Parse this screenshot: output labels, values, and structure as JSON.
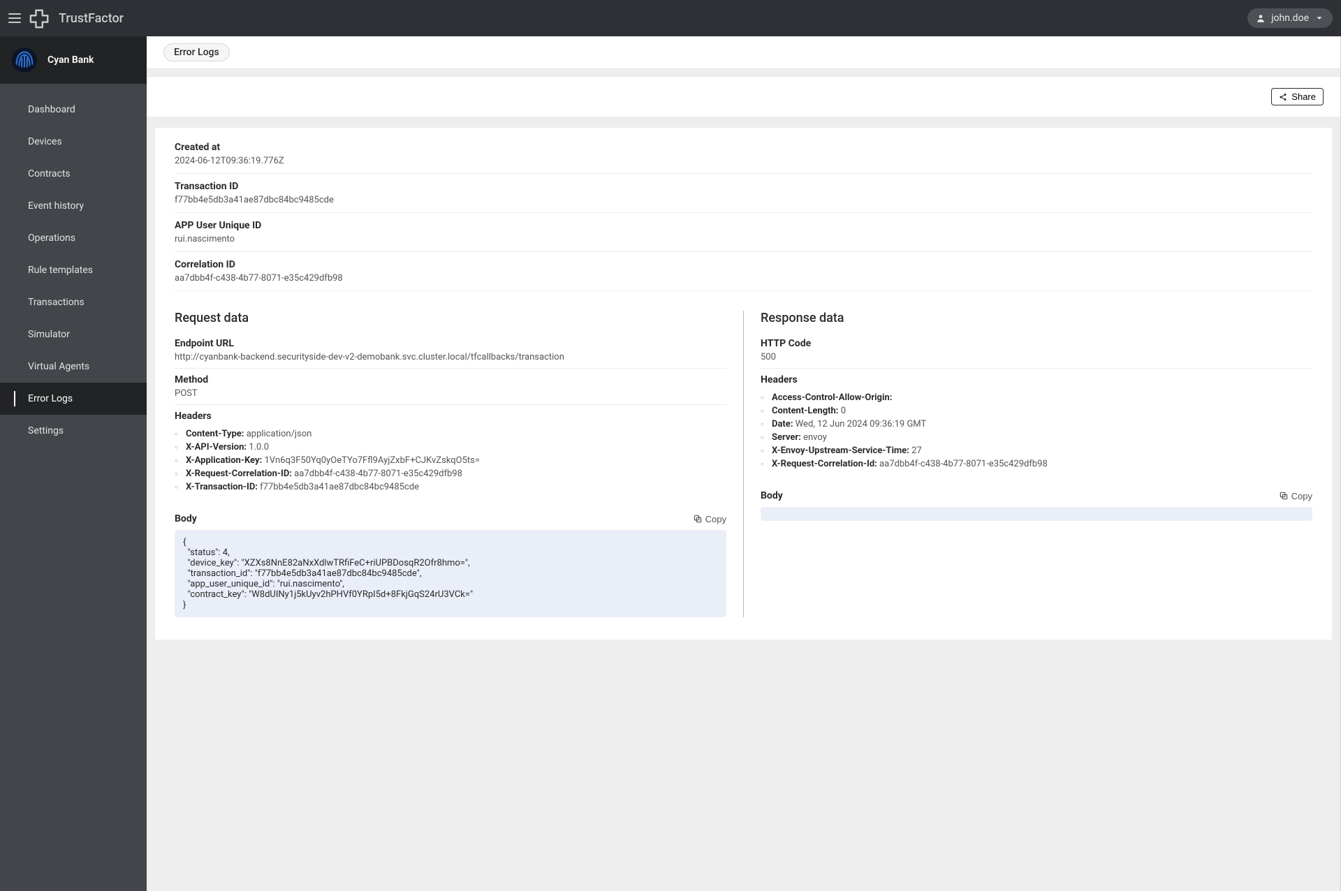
{
  "brand": {
    "name": "TrustFactor"
  },
  "user": {
    "name": "john.doe"
  },
  "org": {
    "name": "Cyan Bank"
  },
  "sidebar": {
    "items": [
      {
        "label": "Dashboard",
        "active": false
      },
      {
        "label": "Devices",
        "active": false
      },
      {
        "label": "Contracts",
        "active": false
      },
      {
        "label": "Event history",
        "active": false
      },
      {
        "label": "Operations",
        "active": false
      },
      {
        "label": "Rule templates",
        "active": false
      },
      {
        "label": "Transactions",
        "active": false
      },
      {
        "label": "Simulator",
        "active": false
      },
      {
        "label": "Virtual Agents",
        "active": false
      },
      {
        "label": "Error Logs",
        "active": true
      },
      {
        "label": "Settings",
        "active": false
      }
    ]
  },
  "tabs": {
    "active_label": "Error Logs"
  },
  "toolbar": {
    "share_label": "Share"
  },
  "meta": {
    "created_at": {
      "label": "Created at",
      "value": "2024-06-12T09:36:19.776Z"
    },
    "transaction_id": {
      "label": "Transaction ID",
      "value": "f77bb4e5db3a41ae87dbc84bc9485cde"
    },
    "app_user_id": {
      "label": "APP User Unique ID",
      "value": "rui.nascimento"
    },
    "correlation_id": {
      "label": "Correlation ID",
      "value": "aa7dbb4f-c438-4b77-8071-e35c429dfb98"
    }
  },
  "request": {
    "title": "Request data",
    "endpoint": {
      "label": "Endpoint URL",
      "value": "http://cyanbank-backend.securityside-dev-v2-demobank.svc.cluster.local/tfcallbacks/transaction"
    },
    "method": {
      "label": "Method",
      "value": "POST"
    },
    "headers_label": "Headers",
    "headers": [
      {
        "k": "Content-Type:",
        "v": "application/json"
      },
      {
        "k": "X-API-Version:",
        "v": "1.0.0"
      },
      {
        "k": "X-Application-Key:",
        "v": "1Vn6q3F50Yq0yOeTYo7Ffl9AyjZxbF+CJKvZskqO5ts="
      },
      {
        "k": "X-Request-Correlation-ID:",
        "v": "aa7dbb4f-c438-4b77-8071-e35c429dfb98"
      },
      {
        "k": "X-Transaction-ID:",
        "v": "f77bb4e5db3a41ae87dbc84bc9485cde"
      }
    ],
    "body_label": "Body",
    "copy_label": "Copy",
    "body": "{\n  \"status\": 4,\n  \"device_key\": \"XZXs8NnE82aNxXdlwTRfiFeC+riUPBDosqR2Ofr8hmo=\",\n  \"transaction_id\": \"f77bb4e5db3a41ae87dbc84bc9485cde\",\n  \"app_user_unique_id\": \"rui.nascimento\",\n  \"contract_key\": \"W8dUINy1j5kUyv2hPHVf0YRpI5d+8FkjGqS24rU3VCk=\"\n}"
  },
  "response": {
    "title": "Response data",
    "http_code": {
      "label": "HTTP Code",
      "value": "500"
    },
    "headers_label": "Headers",
    "headers": [
      {
        "k": "Access-Control-Allow-Origin:",
        "v": ""
      },
      {
        "k": "Content-Length:",
        "v": "0"
      },
      {
        "k": "Date:",
        "v": "Wed, 12 Jun 2024 09:36:19 GMT"
      },
      {
        "k": "Server:",
        "v": "envoy"
      },
      {
        "k": "X-Envoy-Upstream-Service-Time:",
        "v": "27"
      },
      {
        "k": "X-Request-Correlation-Id:",
        "v": "aa7dbb4f-c438-4b77-8071-e35c429dfb98"
      }
    ],
    "body_label": "Body",
    "copy_label": "Copy",
    "body": ""
  }
}
